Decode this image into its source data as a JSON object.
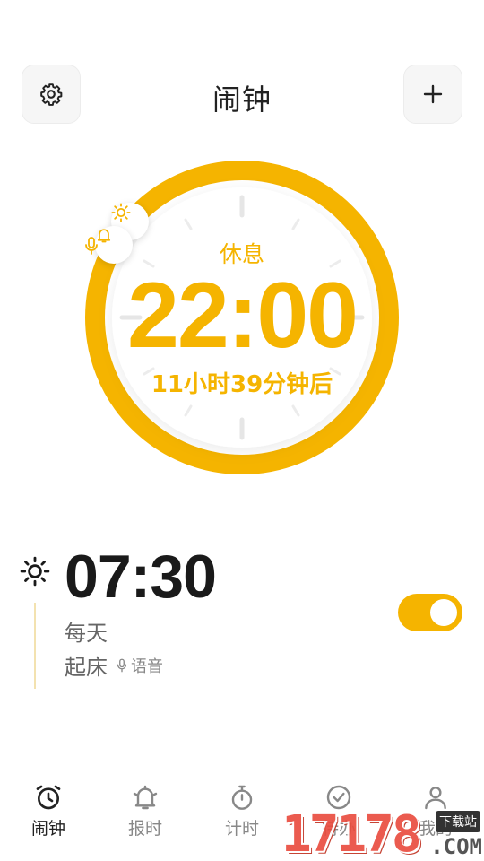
{
  "header": {
    "title": "闹钟",
    "settings_icon": "gear-icon",
    "add_icon": "plus-icon"
  },
  "clock": {
    "label": "休息",
    "time": "22:00",
    "countdown": "11小时39分钟后",
    "accent": "#f5b400"
  },
  "alarm": {
    "time": "07:30",
    "repeat": "每天",
    "name": "起床",
    "voice_label": "语音",
    "enabled": true
  },
  "tabs": [
    {
      "label": "闹钟",
      "icon": "alarm-clock-icon",
      "active": true
    },
    {
      "label": "报时",
      "icon": "bell-icon",
      "active": false
    },
    {
      "label": "计时",
      "icon": "stopwatch-icon",
      "active": false
    },
    {
      "label": "待办",
      "icon": "check-circle-icon",
      "active": false
    },
    {
      "label": "我的",
      "icon": "person-icon",
      "active": false
    }
  ],
  "watermark": {
    "digits": "17178",
    "tag": "下载站",
    "domain": ".COM"
  }
}
